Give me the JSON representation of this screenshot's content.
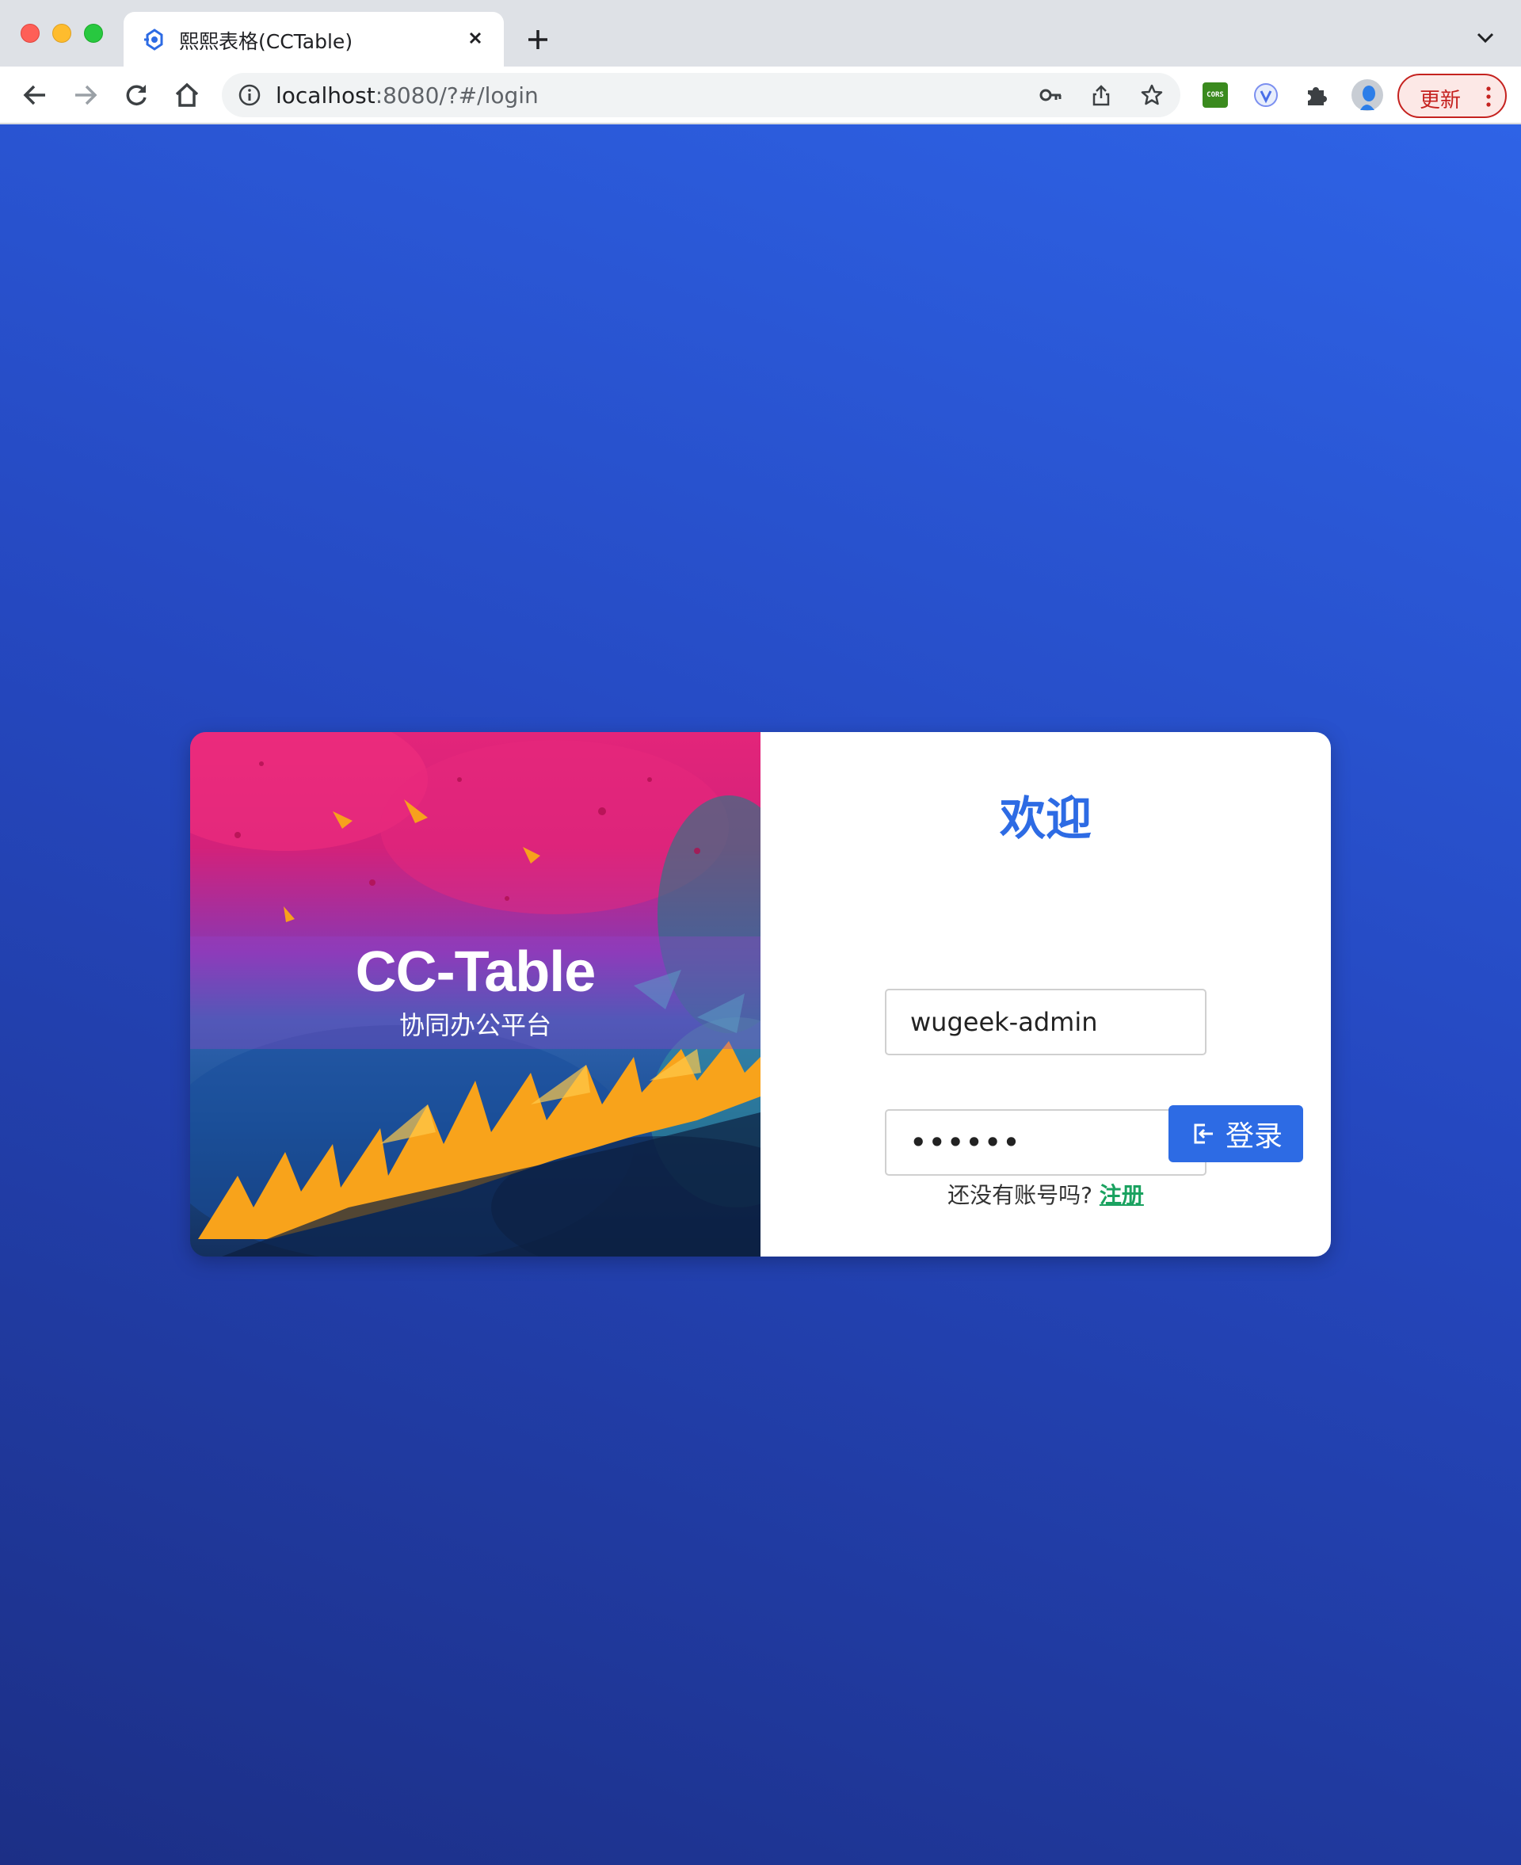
{
  "browser": {
    "tab_title": "熙熙表格(CCTable)",
    "url_host": "localhost",
    "url_rest": ":8080/?#/login",
    "update_button_label": "更新",
    "extension_cors_label": "CORS"
  },
  "login": {
    "brand_title": "CC-Table",
    "brand_subtitle": "协同办公平台",
    "welcome_heading": "欢迎",
    "username_value": "wugeek-admin",
    "password_value": "••••••",
    "login_button_label": "登录",
    "register_prompt": "还没有账号吗?",
    "register_link_label": "注册"
  },
  "colors": {
    "accent": "#2d6be4",
    "register_link": "#1aa260",
    "update_button": "#c5221f",
    "background_top": "#2e63e6",
    "background_bottom": "#1c2f86"
  },
  "icons": {
    "tab_favicon": "cctable-logo-icon",
    "login_button": "login-enter-icon"
  }
}
